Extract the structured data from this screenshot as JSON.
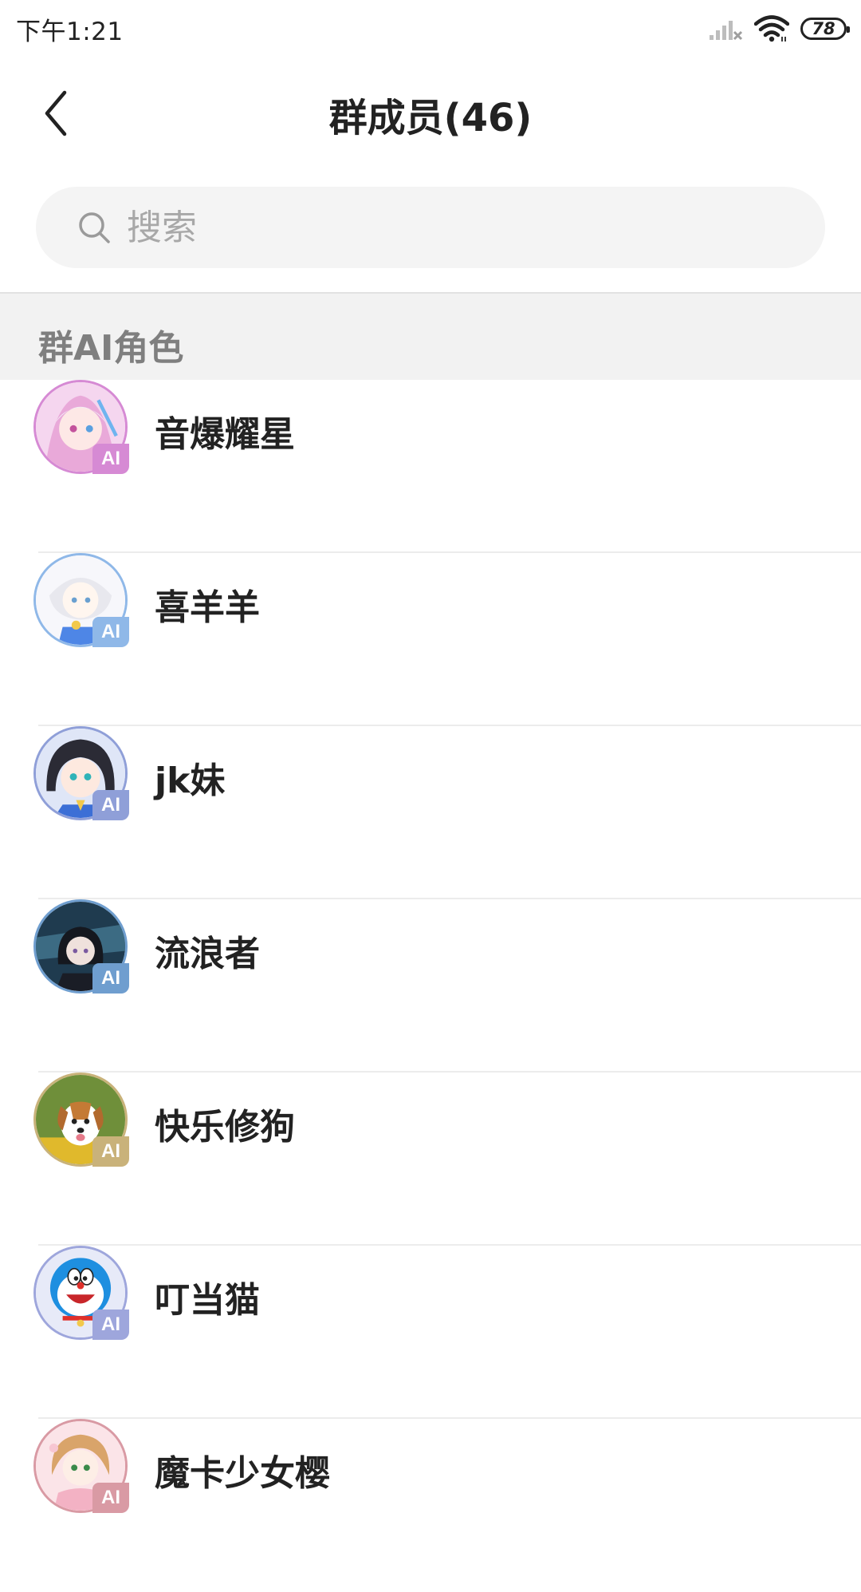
{
  "status_bar": {
    "time": "下午1:21",
    "battery": "78",
    "icons": [
      "signal-icon",
      "wifi-icon",
      "battery-icon"
    ]
  },
  "header": {
    "back_icon": "chevron-left-icon",
    "title": "群成员(46)"
  },
  "search": {
    "placeholder": "搜索",
    "icon": "search-icon"
  },
  "section": {
    "title": "群AI角色"
  },
  "members": [
    {
      "name": "音爆耀星",
      "badge": "AI",
      "color": "#d68ad4"
    },
    {
      "name": "喜羊羊",
      "badge": "AI",
      "color": "#8fb8e8"
    },
    {
      "name": "jk妹",
      "badge": "AI",
      "color": "#8f9fd8"
    },
    {
      "name": "流浪者",
      "badge": "AI",
      "color": "#6f9ecf"
    },
    {
      "name": "快乐修狗",
      "badge": "AI",
      "color": "#c9b27a"
    },
    {
      "name": "叮当猫",
      "badge": "AI",
      "color": "#9ea6dc"
    },
    {
      "name": "魔卡少女樱",
      "badge": "AI",
      "color": "#d99aa4"
    }
  ]
}
